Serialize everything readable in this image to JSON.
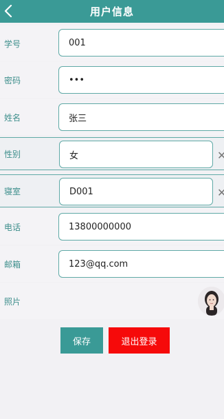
{
  "header": {
    "title": "用户信息",
    "back_icon": "chevron-left-icon"
  },
  "fields": {
    "student_id": {
      "label": "学号",
      "value": "001"
    },
    "password": {
      "label": "密码",
      "value": "•••"
    },
    "name": {
      "label": "姓名",
      "value": "张三"
    },
    "gender": {
      "label": "性别",
      "value": "女"
    },
    "dorm": {
      "label": "寝室",
      "value": "D001"
    },
    "phone": {
      "label": "电话",
      "value": "13800000000"
    },
    "email": {
      "label": "邮箱",
      "value": "123@qq.com"
    },
    "photo": {
      "label": "照片"
    }
  },
  "buttons": {
    "save": "保存",
    "logout": "退出登录"
  },
  "colors": {
    "primary": "#3a9a96",
    "danger": "#f60a0a"
  }
}
